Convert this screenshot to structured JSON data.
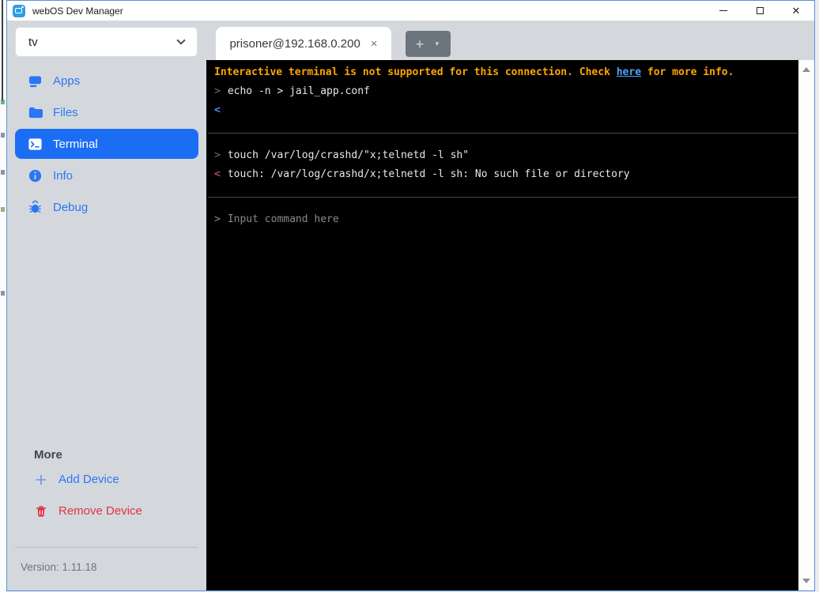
{
  "window": {
    "title": "webOS Dev Manager",
    "controls": {
      "minimize": "minimize",
      "maximize": "maximize",
      "close_glyph": "✕"
    }
  },
  "sidebar": {
    "device_selector": {
      "value": "tv",
      "icon": "chevron-down-icon"
    },
    "nav": [
      {
        "label": "Apps",
        "icon": "apps-icon",
        "active": false
      },
      {
        "label": "Files",
        "icon": "folder-icon",
        "active": false
      },
      {
        "label": "Terminal",
        "icon": "terminal-icon",
        "active": true
      },
      {
        "label": "Info",
        "icon": "info-icon",
        "active": false
      },
      {
        "label": "Debug",
        "icon": "bug-icon",
        "active": false
      }
    ],
    "more": {
      "label": "More",
      "add_label": "Add Device",
      "add_icon": "plus-icon",
      "remove_label": "Remove Device",
      "remove_icon": "trash-icon"
    },
    "version": "Version: 1.11.18"
  },
  "tabs": {
    "active": {
      "label": "prisoner@192.168.0.200",
      "close_glyph": "×"
    },
    "new_tab": {
      "plus_glyph": "+",
      "caret_glyph": "▼"
    }
  },
  "terminal": {
    "notice": {
      "before": "Interactive terminal is not supported for this connection. Check ",
      "link": "here",
      "after": " for more info."
    },
    "blocks": [
      {
        "lines": [
          {
            "prompt": ">",
            "type": "input",
            "text": "echo -n > jail_app.conf"
          },
          {
            "prompt": "<",
            "type": "response",
            "text": ""
          }
        ]
      },
      {
        "lines": [
          {
            "prompt": ">",
            "type": "input",
            "text": "touch /var/log/crashd/\"x;telnetd -l sh\""
          },
          {
            "prompt": "<",
            "type": "response-error",
            "text": "touch: /var/log/crashd/x;telnetd -l sh: No such file or directory"
          }
        ]
      }
    ],
    "input": {
      "prompt": ">",
      "placeholder": "Input command here"
    }
  },
  "colors": {
    "accent_blue": "#1b6ef3",
    "nav_blue": "#2b77f3",
    "danger_red": "#dc3545",
    "warning_orange": "#ffa500",
    "link_blue": "#4da3ff",
    "response_blue": "#4f8ef7",
    "error_red": "#dd5f69",
    "sidebar_bg": "#d4d8dd",
    "terminal_bg": "#000000",
    "window_border": "#5596d8",
    "new_tab_gray": "#6c757d"
  }
}
